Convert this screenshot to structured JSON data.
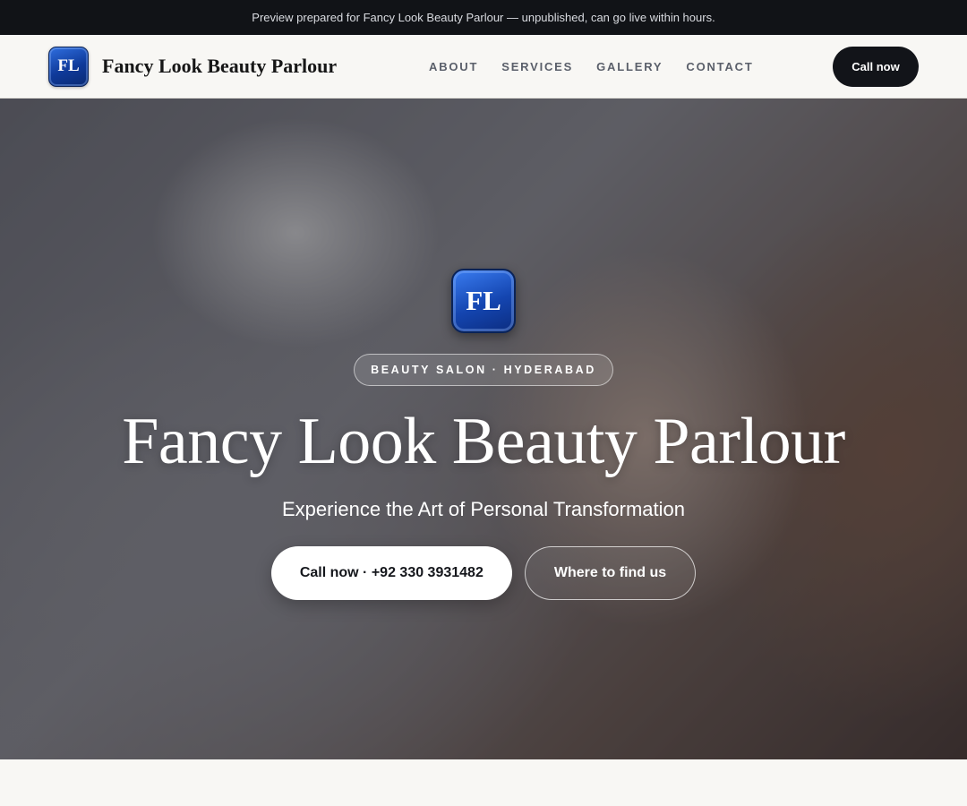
{
  "announcement": "Preview prepared for Fancy Look Beauty Parlour — unpublished, can go live within hours.",
  "header": {
    "logo_initials": "FL",
    "brand_name": "Fancy Look Beauty Parlour",
    "nav": [
      {
        "label": "ABOUT"
      },
      {
        "label": "SERVICES"
      },
      {
        "label": "GALLERY"
      },
      {
        "label": "CONTACT"
      }
    ],
    "cta_label": "Call now"
  },
  "hero": {
    "logo_initials": "FL",
    "eyebrow": "BEAUTY SALON · HYDERABAD",
    "title": "Fancy Look Beauty Parlour",
    "subtitle": "Experience the Art of Personal Transformation",
    "primary_button": "Call now · +92 330 3931482",
    "secondary_button": "Where to find us"
  },
  "colors": {
    "accent_dark": "#121419",
    "logo_blue": "#1445b0",
    "background": "#f8f7f4"
  }
}
